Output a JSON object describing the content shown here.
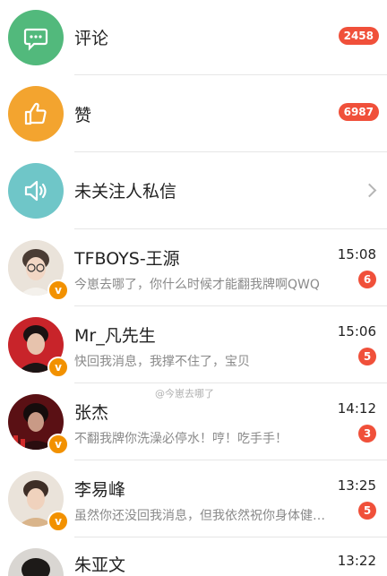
{
  "system_rows": [
    {
      "label": "评论",
      "badge": "2458",
      "icon": "comment-icon",
      "color": "#52b97c"
    },
    {
      "label": "赞",
      "badge": "6987",
      "icon": "thumbs-up-icon",
      "color": "#f3a42f"
    },
    {
      "label": "未关注人私信",
      "icon": "speaker-icon",
      "color": "#6fc6c8"
    }
  ],
  "chats": [
    {
      "name": "TFBOYS-王源",
      "time": "15:08",
      "preview": "今崽去哪了，你什么时候才能翻我牌啊QWQ",
      "count": "6",
      "verified": "v"
    },
    {
      "name": "Mr_凡先生",
      "time": "15:06",
      "preview": "快回我消息，我撑不住了，宝贝",
      "count": "5",
      "verified": "v"
    },
    {
      "name": "张杰",
      "time": "14:12",
      "preview": "不翻我牌你洗澡必停水！哼！吃手手！",
      "count": "3",
      "verified": "v"
    },
    {
      "name": "李易峰",
      "time": "13:25",
      "preview": "虽然你还没回我消息，但我依然祝你身体健…",
      "count": "5",
      "verified": "v"
    },
    {
      "name": "朱亚文",
      "time": "13:22"
    }
  ],
  "watermark": "@今崽去哪了"
}
